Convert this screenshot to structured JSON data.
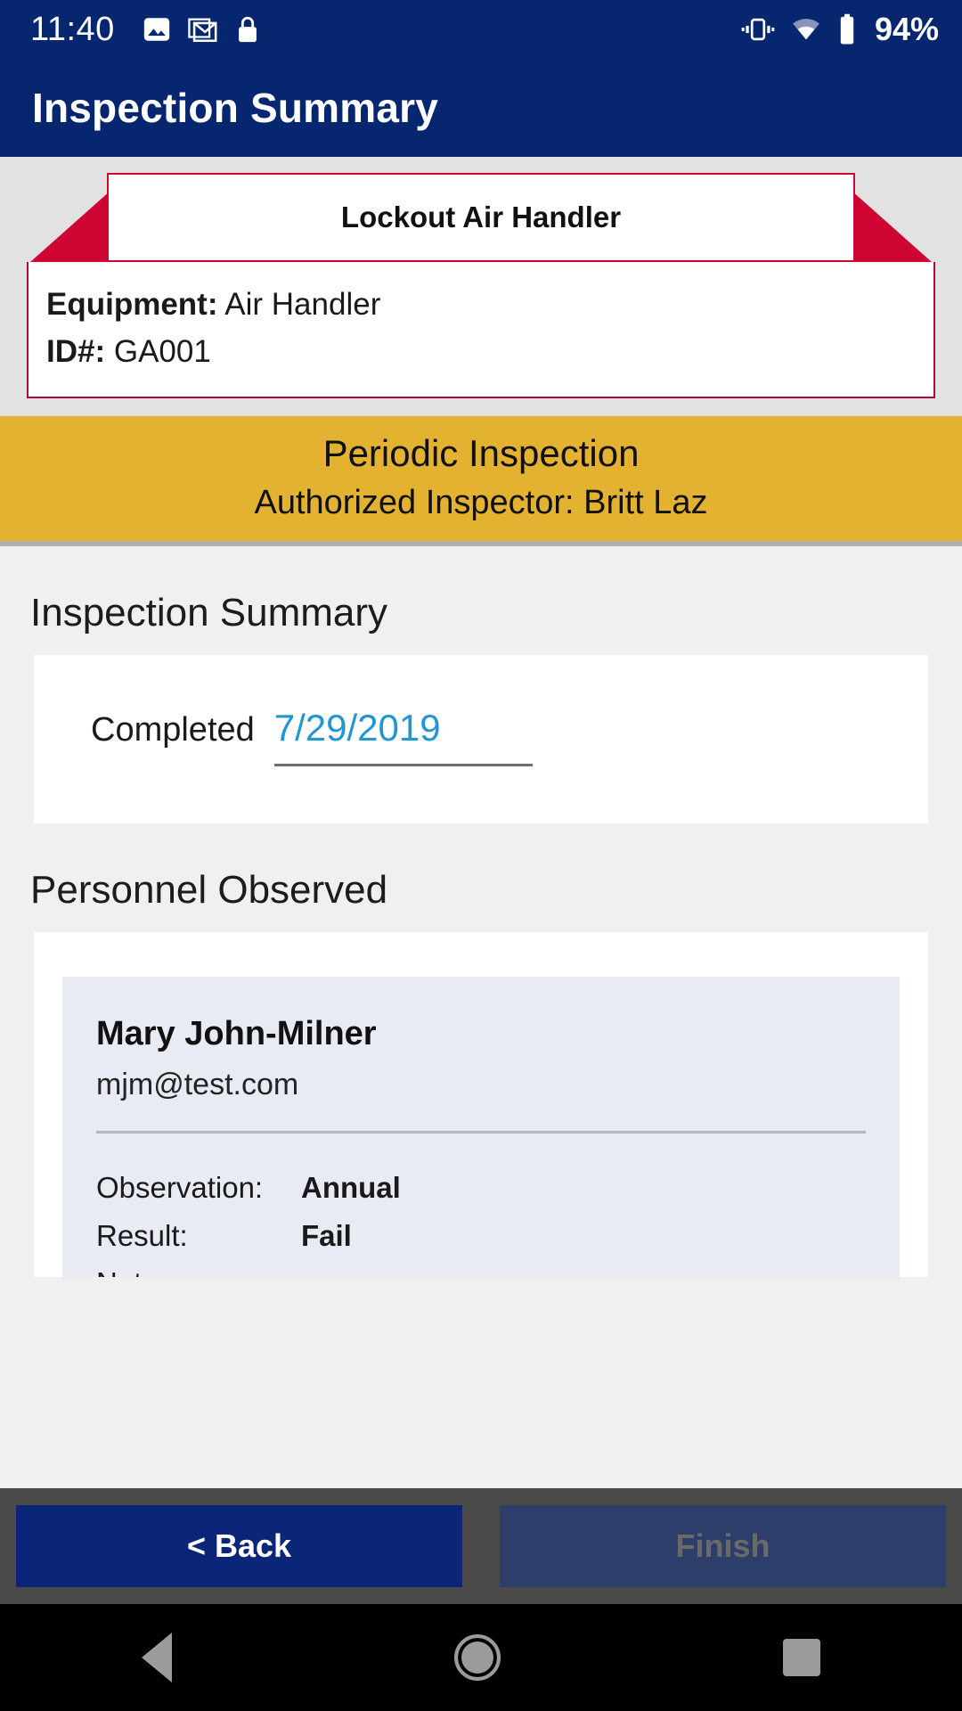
{
  "status_bar": {
    "time": "11:40",
    "battery_percent": "94%",
    "left_icons": [
      "photo-icon",
      "gmail-icon",
      "lock-icon"
    ],
    "right_icons": [
      "vibrate-icon",
      "wifi-icon",
      "battery-icon"
    ]
  },
  "app_bar": {
    "title": "Inspection Summary"
  },
  "equipment_banner": {
    "ribbon_title": "Lockout Air Handler",
    "equipment_label": "Equipment:",
    "equipment_value": "Air Handler",
    "id_label": "ID#:",
    "id_value": "GA001",
    "ribbon_color": "#CE0533",
    "border_color": "#AD0B35"
  },
  "inspection_band": {
    "type": "Periodic Inspection",
    "inspector": "Authorized Inspector: Britt Laz",
    "background_color": "#E4B231"
  },
  "summary_section": {
    "heading": "Inspection Summary",
    "completed_label": "Completed",
    "completed_date": "7/29/2019",
    "date_color": "#2196D0"
  },
  "personnel_section": {
    "heading": "Personnel Observed",
    "people": [
      {
        "name": "Mary John-Milner",
        "email": "mjm@test.com",
        "observation_label": "Observation:",
        "observation_value": "Annual",
        "result_label": "Result:",
        "result_value": "Fail",
        "notes_label": "Notes:",
        "notes_value": ""
      }
    ]
  },
  "action_bar": {
    "back_label": "< Back",
    "finish_label": "Finish",
    "back_color": "#0B2678",
    "finish_disabled": true
  },
  "nav_bar": {
    "buttons": [
      "back-triangle-icon",
      "home-circle-icon",
      "recents-square-icon"
    ]
  }
}
